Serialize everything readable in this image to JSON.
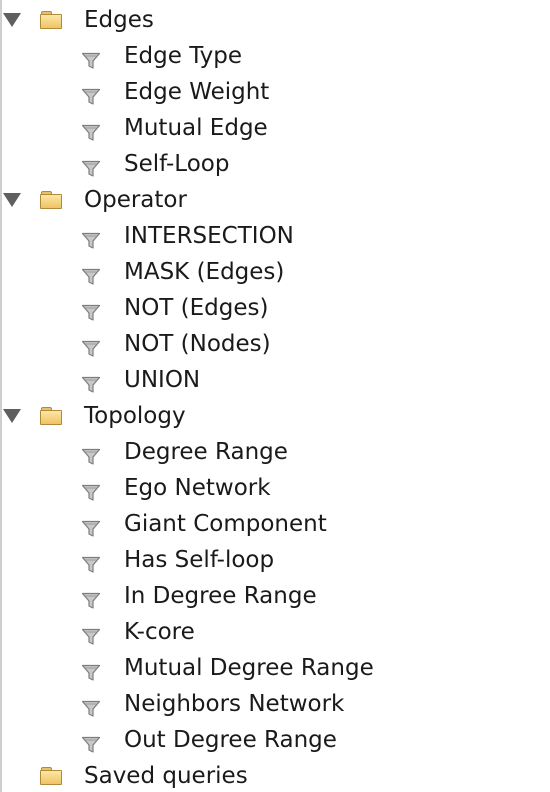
{
  "tree": [
    {
      "label": "Edges",
      "icon": "folder-icon",
      "expanded": true,
      "children": [
        "Edge Type",
        "Edge Weight",
        "Mutual Edge",
        "Self-Loop"
      ]
    },
    {
      "label": "Operator",
      "icon": "folder-icon",
      "expanded": true,
      "children": [
        "INTERSECTION",
        "MASK (Edges)",
        "NOT (Edges)",
        "NOT (Nodes)",
        "UNION"
      ]
    },
    {
      "label": "Topology",
      "icon": "folder-icon",
      "expanded": true,
      "children": [
        "Degree Range",
        "Ego Network",
        "Giant Component",
        "Has Self-loop",
        "In Degree Range",
        "K-core",
        "Mutual Degree Range",
        "Neighbors Network",
        "Out Degree Range"
      ]
    },
    {
      "label": "Saved queries",
      "icon": "folder-icon",
      "expanded": false,
      "children": []
    }
  ],
  "child_icon": "filter-funnel-icon",
  "colors": {
    "folder": "#efc463",
    "filter_icon": "#8a8a8a",
    "text": "#1a1a1a",
    "toggle": "#5f5f5f"
  }
}
